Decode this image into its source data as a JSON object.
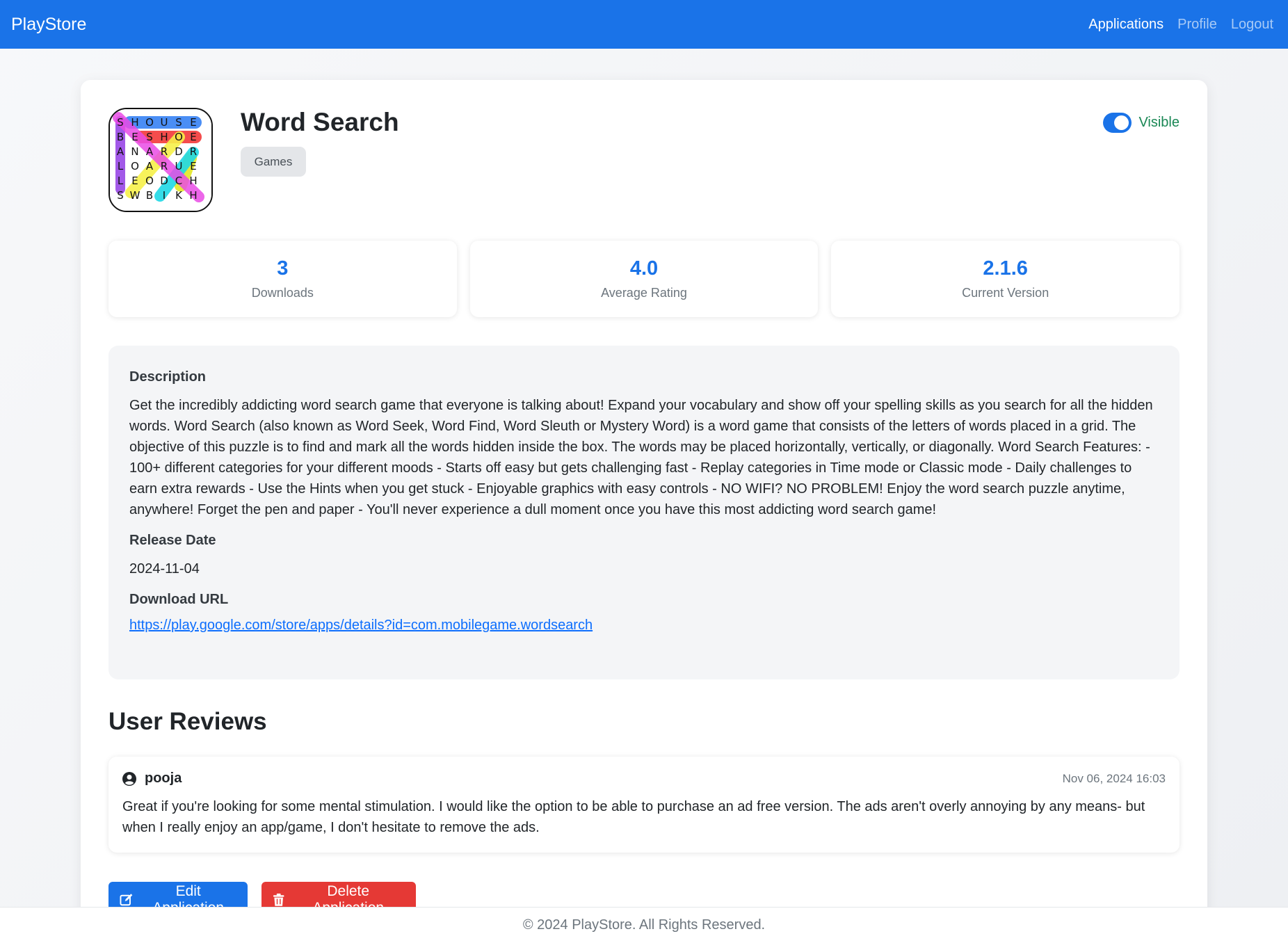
{
  "nav": {
    "brand": "PlayStore",
    "links": [
      {
        "label": "Applications"
      },
      {
        "label": "Profile"
      },
      {
        "label": "Logout"
      }
    ]
  },
  "app": {
    "icon_grid": [
      [
        "S",
        "H",
        "O",
        "U",
        "S",
        "E"
      ],
      [
        "B",
        "E",
        "S",
        "H",
        "O",
        "E"
      ],
      [
        "A",
        "N",
        "A",
        "R",
        "D",
        "R"
      ],
      [
        "L",
        "O",
        "A",
        "R",
        "U",
        "E"
      ],
      [
        "L",
        "E",
        "O",
        "D",
        "C",
        "H"
      ],
      [
        "S",
        "W",
        "B",
        "I",
        "K",
        "H"
      ]
    ],
    "title": "Word Search",
    "category": "Games",
    "visibility_label": "Visible",
    "visible": true
  },
  "stats": [
    {
      "value": "3",
      "label": "Downloads"
    },
    {
      "value": "4.0",
      "label": "Average Rating"
    },
    {
      "value": "2.1.6",
      "label": "Current Version"
    }
  ],
  "details": {
    "description_heading": "Description",
    "description": "Get the incredibly addicting word search game that everyone is talking about! Expand your vocabulary and show off your spelling skills as you search for all the hidden words. Word Search (also known as Word Seek, Word Find, Word Sleuth or Mystery Word) is a word game that consists of the letters of words placed in a grid. The objective of this puzzle is to find and mark all the words hidden inside the box. The words may be placed horizontally, vertically, or diagonally. Word Search Features: - 100+ different categories for your different moods - Starts off easy but gets challenging fast - Replay categories in Time mode or Classic mode - Daily challenges to earn extra rewards - Use the Hints when you get stuck - Enjoyable graphics with easy controls - NO WIFI? NO PROBLEM! Enjoy the word search puzzle anytime, anywhere! Forget the pen and paper - You'll never experience a dull moment once you have this most addicting word search game!",
    "release_heading": "Release Date",
    "release_date": "2024-11-04",
    "url_heading": "Download URL",
    "url": "https://play.google.com/store/apps/details?id=com.mobilegame.wordsearch"
  },
  "reviews": {
    "title": "User Reviews",
    "items": [
      {
        "user": "pooja",
        "date": "Nov 06, 2024 16:03",
        "text": "Great if you're looking for some mental stimulation. I would like the option to be able to purchase an ad free version. The ads aren't overly annoying by any means- but when I really enjoy an app/game, I don't hesitate to remove the ads."
      }
    ]
  },
  "actions": {
    "edit_label": "Edit Application",
    "delete_label": "Delete Application"
  },
  "footer": {
    "text": "© 2024 PlayStore. All Rights Reserved."
  },
  "colors": {
    "primary": "#1a73e8",
    "danger": "#e53935",
    "success": "#198754"
  }
}
